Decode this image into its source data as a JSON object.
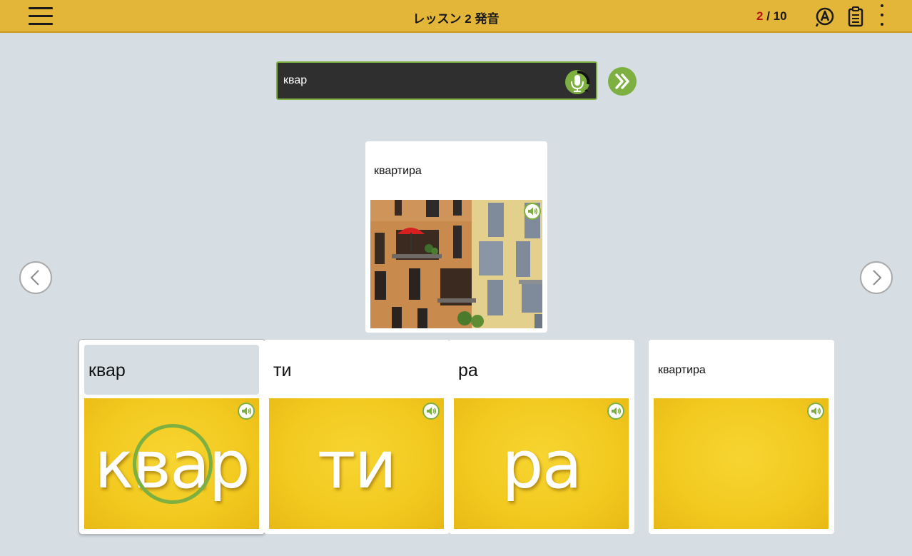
{
  "header": {
    "title": "レッスン 2 発音",
    "progress_current": "2",
    "progress_total": "/ 10"
  },
  "speech": {
    "recognized_text": "квар"
  },
  "word_card": {
    "word": "квартира"
  },
  "syllables": [
    {
      "label": "квар",
      "image_text": "квар"
    },
    {
      "label": "ти",
      "image_text": "ти"
    },
    {
      "label": "ра",
      "image_text": "ра"
    },
    {
      "label": "квартира",
      "image_text": ""
    }
  ],
  "colors": {
    "header_bg": "#e3b63a",
    "accent_green": "#7db040",
    "progress_current": "#b81818",
    "page_bg": "#d6dee3"
  },
  "icons": {
    "menu": "hamburger-icon",
    "auto_play": "circled-a-icon",
    "notes": "clipboard-icon",
    "more": "kebab-icon",
    "mic": "microphone-icon",
    "next": "double-chevron-right-icon",
    "prev_arrow": "chevron-left-icon",
    "next_arrow": "chevron-right-icon",
    "audio": "speaker-icon"
  }
}
